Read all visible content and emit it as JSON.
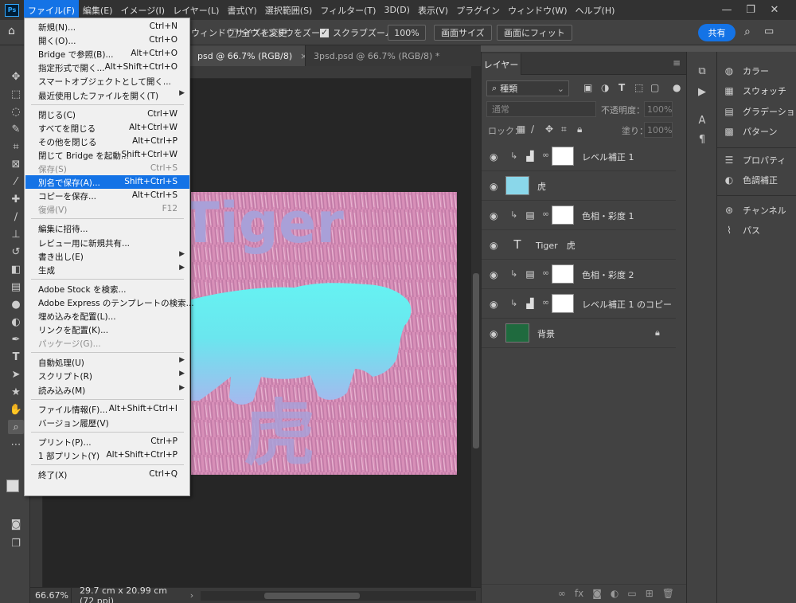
{
  "menubar": {
    "logo": "Ps",
    "items": [
      "ファイル(F)",
      "編集(E)",
      "イメージ(I)",
      "レイヤー(L)",
      "書式(Y)",
      "選択範囲(S)",
      "フィルター(T)",
      "3D(D)",
      "表示(V)",
      "プラグイン",
      "ウィンドウ(W)",
      "ヘルプ(H)"
    ],
    "window_controls": [
      "minimize-icon",
      "restore-icon",
      "close-icon"
    ]
  },
  "options": {
    "resize_windows": "ウィンドウサイズを変更",
    "zoom_all": "全ウィンドウをズーム",
    "zoom_all_checked": false,
    "scrubby_zoom": "スクラブズーム",
    "scrubby_zoom_checked": true,
    "zoom_value": "100%",
    "fit_screen": "画面サイズ",
    "fill_screen": "画面にフィット",
    "share": "共有"
  },
  "document_tabs": [
    {
      "title": "psd @ 66.7% (RGB/8)",
      "active": true
    },
    {
      "title": "3psd.psd @ 66.7% (RGB/8) *",
      "active": false
    }
  ],
  "tab_close": "×",
  "artwork": {
    "title_text": "Tiger",
    "kanji": "虎"
  },
  "status_bar": {
    "zoom": "66.67%",
    "dimensions": "29.7 cm x 20.99 cm (72 ppi)",
    "chevron": "›"
  },
  "file_menu": {
    "groups": [
      [
        {
          "label": "新規(N)...",
          "shortcut": "Ctrl+N"
        },
        {
          "label": "開く(O)...",
          "shortcut": "Ctrl+O"
        },
        {
          "label": "Bridge で参照(B)...",
          "shortcut": "Alt+Ctrl+O"
        },
        {
          "label": "指定形式で開く...",
          "shortcut": "Alt+Shift+Ctrl+O"
        },
        {
          "label": "スマートオブジェクトとして開く...",
          "shortcut": ""
        },
        {
          "label": "最近使用したファイルを開く(T)",
          "shortcut": "",
          "submenu": true
        }
      ],
      [
        {
          "label": "閉じる(C)",
          "shortcut": "Ctrl+W"
        },
        {
          "label": "すべてを閉じる",
          "shortcut": "Alt+Ctrl+W"
        },
        {
          "label": "その他を閉じる",
          "shortcut": "Alt+Ctrl+P"
        },
        {
          "label": "閉じて Bridge を起動...",
          "shortcut": "Shift+Ctrl+W"
        },
        {
          "label": "保存(S)",
          "shortcut": "Ctrl+S",
          "disabled": true
        },
        {
          "label": "別名で保存(A)...",
          "shortcut": "Shift+Ctrl+S",
          "highlighted": true
        },
        {
          "label": "コピーを保存...",
          "shortcut": "Alt+Ctrl+S"
        },
        {
          "label": "復帰(V)",
          "shortcut": "F12",
          "disabled": true
        }
      ],
      [
        {
          "label": "編集に招待...",
          "shortcut": ""
        },
        {
          "label": "レビュー用に新規共有...",
          "shortcut": ""
        },
        {
          "label": "書き出し(E)",
          "shortcut": "",
          "submenu": true
        },
        {
          "label": "生成",
          "shortcut": "",
          "submenu": true
        }
      ],
      [
        {
          "label": "Adobe Stock を検索...",
          "shortcut": ""
        },
        {
          "label": "Adobe Express のテンプレートの検索...",
          "shortcut": ""
        },
        {
          "label": "埋め込みを配置(L)...",
          "shortcut": ""
        },
        {
          "label": "リンクを配置(K)...",
          "shortcut": ""
        },
        {
          "label": "パッケージ(G)...",
          "shortcut": "",
          "disabled": true
        }
      ],
      [
        {
          "label": "自動処理(U)",
          "shortcut": "",
          "submenu": true
        },
        {
          "label": "スクリプト(R)",
          "shortcut": "",
          "submenu": true
        },
        {
          "label": "読み込み(M)",
          "shortcut": "",
          "submenu": true
        }
      ],
      [
        {
          "label": "ファイル情報(F)...",
          "shortcut": "Alt+Shift+Ctrl+I"
        },
        {
          "label": "バージョン履歴(V)",
          "shortcut": ""
        }
      ],
      [
        {
          "label": "プリント(P)...",
          "shortcut": "Ctrl+P"
        },
        {
          "label": "1 部プリント(Y)",
          "shortcut": "Alt+Shift+Ctrl+P"
        }
      ],
      [
        {
          "label": "終了(X)",
          "shortcut": "Ctrl+Q"
        }
      ]
    ],
    "submenu_arrow": "▶"
  },
  "layers_panel": {
    "tab": "レイヤー",
    "filter": "種類",
    "blend_mode": "通常",
    "opacity_label": "不透明度：",
    "opacity_value": "100%",
    "lock_label": "ロック：",
    "fill_label": "塗り：",
    "fill_value": "100%",
    "layers": [
      {
        "name": "レベル補正 1",
        "kind": "levels",
        "clipped": true
      },
      {
        "name": "虎",
        "kind": "image",
        "clipped": false
      },
      {
        "name": "色相・彩度 1",
        "kind": "huesat",
        "clipped": true
      },
      {
        "name": "Tiger　虎",
        "kind": "text",
        "clipped": false
      },
      {
        "name": "色相・彩度 2",
        "kind": "huesat",
        "clipped": true
      },
      {
        "name": "レベル補正 1 のコピー",
        "kind": "levels",
        "clipped": true
      },
      {
        "name": "背景",
        "kind": "background",
        "clipped": false,
        "locked": true
      }
    ]
  },
  "right_panels": [
    {
      "label": "カラー",
      "icon": "palette-icon"
    },
    {
      "label": "スウォッチ",
      "icon": "swatches-icon"
    },
    {
      "label": "グラデーション",
      "icon": "gradient-icon"
    },
    {
      "label": "パターン",
      "icon": "pattern-icon"
    },
    {
      "label": "プロパティ",
      "icon": "properties-icon"
    },
    {
      "label": "色調補正",
      "icon": "adjustments-icon"
    },
    {
      "label": "チャンネル",
      "icon": "channels-icon"
    },
    {
      "label": "パス",
      "icon": "paths-icon"
    }
  ],
  "colors": {
    "accent": "#1473e6",
    "menu_bg": "#f0f0f0",
    "panel_bg": "#424242"
  }
}
